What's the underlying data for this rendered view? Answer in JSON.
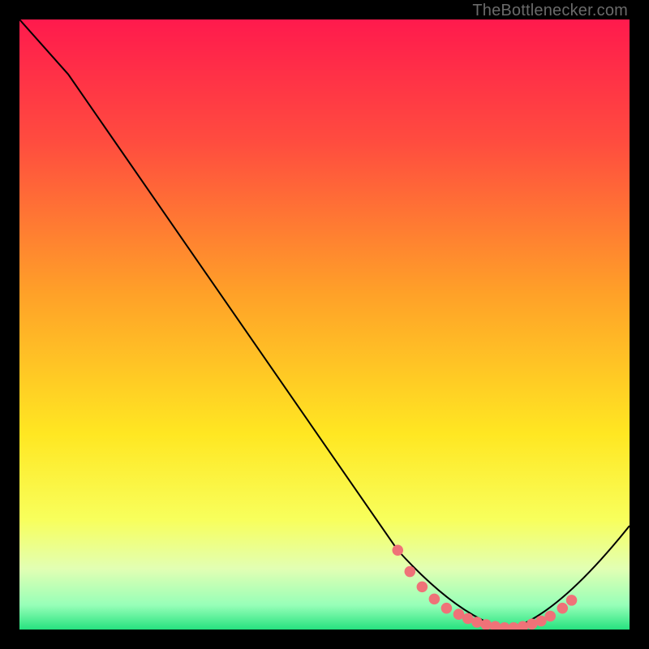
{
  "attribution": "TheBottlenecker.com",
  "gradient_stops": [
    {
      "pct": 0,
      "color": "#ff1a4d"
    },
    {
      "pct": 20,
      "color": "#ff4c3f"
    },
    {
      "pct": 45,
      "color": "#ffa128"
    },
    {
      "pct": 68,
      "color": "#ffe722"
    },
    {
      "pct": 82,
      "color": "#f8ff5c"
    },
    {
      "pct": 90,
      "color": "#e2ffb3"
    },
    {
      "pct": 96,
      "color": "#97ffb8"
    },
    {
      "pct": 100,
      "color": "#26e27f"
    }
  ],
  "chart_data": {
    "type": "line",
    "title": "",
    "xlabel": "",
    "ylabel": "",
    "xlim": [
      0,
      100
    ],
    "ylim": [
      0,
      100
    ],
    "series": [
      {
        "name": "curve",
        "color": "#000000",
        "x": [
          0,
          8,
          62,
          72,
          80,
          88,
          100
        ],
        "y": [
          100,
          91,
          13,
          2,
          0,
          2,
          17
        ]
      }
    ],
    "markers": {
      "name": "highlight-dots",
      "color": "#ef7278",
      "points": [
        {
          "x": 62,
          "y": 13
        },
        {
          "x": 64,
          "y": 9.5
        },
        {
          "x": 66,
          "y": 7
        },
        {
          "x": 68,
          "y": 5
        },
        {
          "x": 70,
          "y": 3.5
        },
        {
          "x": 72,
          "y": 2.5
        },
        {
          "x": 73.5,
          "y": 1.8
        },
        {
          "x": 75,
          "y": 1.2
        },
        {
          "x": 76.5,
          "y": 0.8
        },
        {
          "x": 78,
          "y": 0.5
        },
        {
          "x": 79.5,
          "y": 0.3
        },
        {
          "x": 81,
          "y": 0.3
        },
        {
          "x": 82.5,
          "y": 0.5
        },
        {
          "x": 84,
          "y": 0.9
        },
        {
          "x": 85.5,
          "y": 1.4
        },
        {
          "x": 87,
          "y": 2.2
        },
        {
          "x": 89,
          "y": 3.5
        },
        {
          "x": 90.5,
          "y": 4.8
        }
      ]
    }
  }
}
